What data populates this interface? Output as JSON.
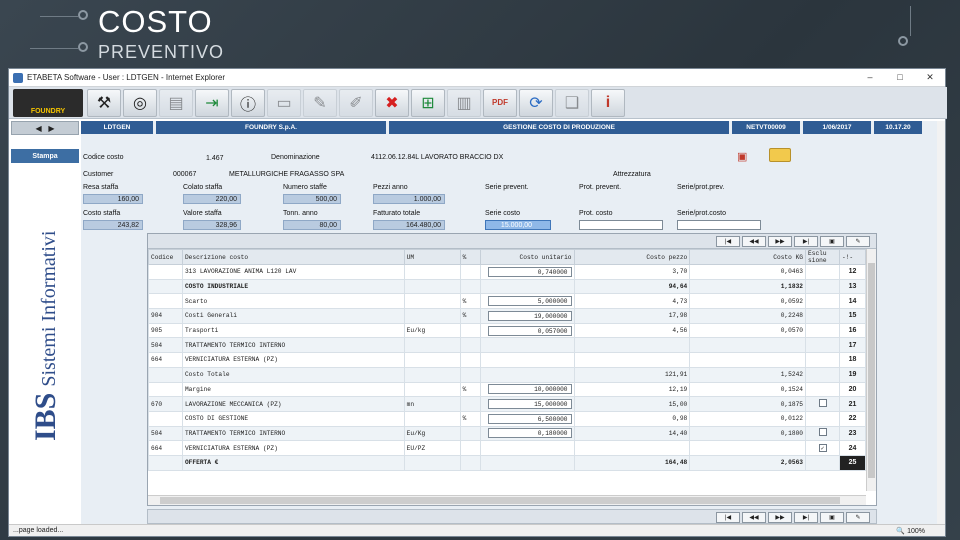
{
  "slide": {
    "title": "COSTO",
    "subtitle": "PREVENTIVO"
  },
  "window": {
    "title": "ETABETA Software - User : LDTGEN - Internet Explorer",
    "controls": [
      "–",
      "□",
      "✕"
    ]
  },
  "toolbar": {
    "logo_text": "FOUNDRY",
    "buttons": [
      {
        "icon": "wrench-icon",
        "glyph": "⚒"
      },
      {
        "icon": "disc-icon",
        "glyph": "◎"
      },
      {
        "icon": "faded-doc-icon",
        "glyph": "▤"
      },
      {
        "icon": "exit-icon",
        "glyph": "⇥"
      },
      {
        "icon": "info-icon",
        "glyph": "ⓘ"
      },
      {
        "icon": "faded-folder-icon",
        "glyph": "▭"
      },
      {
        "icon": "faded-tools-icon",
        "glyph": "✎"
      },
      {
        "icon": "faded-pen-icon",
        "glyph": "✐"
      },
      {
        "icon": "delete-icon",
        "glyph": "✖"
      },
      {
        "icon": "excel-icon",
        "glyph": "⊞"
      },
      {
        "icon": "faded-report-icon",
        "glyph": "▥"
      },
      {
        "icon": "pdf-icon",
        "glyph": "PDF"
      },
      {
        "icon": "refresh-icon",
        "glyph": "⟳"
      },
      {
        "icon": "faded-book-icon",
        "glyph": "❑"
      },
      {
        "icon": "help-icon",
        "glyph": "i"
      }
    ]
  },
  "left_panel": {
    "stampa_label": "Stampa",
    "brand_ibs": "IBS",
    "brand_rest": "Sistemi Informativi"
  },
  "header": {
    "user": "LDTGEN",
    "company": "FOUNDRY S.p.A.",
    "module": "GESTIONE COSTO DI PRODUZIONE",
    "code": "NETVT00009",
    "date": "1/06/2017",
    "time": "10.17.20"
  },
  "form": {
    "codice_costo_label": "Codice costo",
    "codice_costo": "1.467",
    "denominazione_label": "Denominazione",
    "denominazione": "4112.06.12.84L LAVORATO BRACCIO DX",
    "customer_label": "Customer",
    "customer_code": "000067",
    "customer_name": "METALLURGICHE FRAGASSO SPA",
    "attrezzatura_label": "Attrezzatura",
    "resa_staffa_label": "Resa    staffa",
    "resa_staffa": "160,00",
    "colato_staffa_label": "Colato staffa",
    "colato_staffa": "220,00",
    "numero_staffe_label": "Numero staffe",
    "numero_staffe": "500,00",
    "pezzi_anno_label": "Pezzi    anno",
    "pezzi_anno": "1.000,00",
    "serie_prevent_label": "Serie prevent.",
    "prot_prevent_label": "Prot. prevent.",
    "serie_prot_prev_label": "Serie/prot.prev.",
    "costo_staffa_label": "Costo   staffa",
    "costo_staffa": "243,82",
    "valore_staffa_label": "Valore staffa",
    "valore_staffa": "328,96",
    "tonn_anno_label": "Tonn. anno",
    "tonn_anno": "80,00",
    "fatturato_totale_label": "Fatturato totale",
    "fatturato_totale": "164.480,00",
    "serie_costo_label": "Serie costo",
    "serie_costo": "15.000,00",
    "prot_costo_label": "Prot. costo",
    "serie_prot_costo_label": "Serie/prot.costo"
  },
  "nav": [
    "|◀",
    "◀◀",
    "▶▶",
    "▶|",
    "▣",
    "✎"
  ],
  "grid": {
    "columns": [
      "Codice",
      "Descrizione costo",
      "UM",
      "%",
      "Costo unitario",
      "Costo pezzo",
      "Costo KG",
      "Esclu sione",
      "-!-"
    ],
    "rows": [
      {
        "codice": "",
        "descr": "313 LAVORAZIONE ANIMA L120 LAV",
        "um": "",
        "pct": "",
        "unit": "0,740000",
        "pezzo": "3,70",
        "kg": "0,0463",
        "esc": "",
        "n": "12"
      },
      {
        "codice": "",
        "descr": "COSTO INDUSTRIALE",
        "um": "",
        "pct": "",
        "unit": "",
        "pezzo": "94,64",
        "kg": "1,1832",
        "esc": "",
        "n": "13",
        "bold": true
      },
      {
        "codice": "",
        "descr": "Scarto",
        "um": "",
        "pct": "%",
        "unit": "5,000000",
        "pezzo": "4,73",
        "kg": "0,0592",
        "esc": "",
        "n": "14"
      },
      {
        "codice": "904",
        "descr": "Costi Generali",
        "um": "",
        "pct": "%",
        "unit": "19,000000",
        "pezzo": "17,98",
        "kg": "0,2248",
        "esc": "",
        "n": "15"
      },
      {
        "codice": "905",
        "descr": "Trasporti",
        "um": "Eu/kg",
        "pct": "",
        "unit": "0,057000",
        "pezzo": "4,56",
        "kg": "0,0570",
        "esc": "",
        "n": "16"
      },
      {
        "codice": "504",
        "descr": "TRATTAMENTO TERMICO INTERNO",
        "um": "",
        "pct": "",
        "unit": "",
        "pezzo": "",
        "kg": "",
        "esc": "",
        "n": "17"
      },
      {
        "codice": "664",
        "descr": "VERNICIATURA ESTERNA (PZ)",
        "um": "",
        "pct": "",
        "unit": "",
        "pezzo": "",
        "kg": "",
        "esc": "",
        "n": "18"
      },
      {
        "codice": "",
        "descr": "Costo Totale",
        "um": "",
        "pct": "",
        "unit": "",
        "pezzo": "121,91",
        "kg": "1,5242",
        "esc": "",
        "n": "19"
      },
      {
        "codice": "",
        "descr": "Margine",
        "um": "",
        "pct": "%",
        "unit": "10,000000",
        "pezzo": "12,19",
        "kg": "0,1524",
        "esc": "",
        "n": "20"
      },
      {
        "codice": "670",
        "descr": "LAVORAZIONE MECCANICA (PZ)",
        "um": "mn",
        "pct": "",
        "unit": "15,000000",
        "pezzo": "15,00",
        "kg": "0,1875",
        "esc": "box",
        "n": "21"
      },
      {
        "codice": "",
        "descr": "COSTO DI GESTIONE",
        "um": "",
        "pct": "%",
        "unit": "6,500000",
        "pezzo": "0,98",
        "kg": "0,0122",
        "esc": "",
        "n": "22"
      },
      {
        "codice": "504",
        "descr": "TRATTAMENTO TERMICO INTERNO",
        "um": "Eu/Kg",
        "pct": "",
        "unit": "0,180000",
        "pezzo": "14,40",
        "kg": "0,1800",
        "esc": "box",
        "n": "23"
      },
      {
        "codice": "664",
        "descr": "VERNICIATURA ESTERNA (PZ)",
        "um": "EU/PZ",
        "pct": "",
        "unit": "",
        "pezzo": "",
        "kg": "",
        "esc": "checked",
        "n": "24"
      },
      {
        "codice": "",
        "descr": "OFFERTA  €",
        "um": "",
        "pct": "",
        "unit": "",
        "pezzo": "164,48",
        "kg": "2,0563",
        "esc": "",
        "n": "25",
        "bold": true
      }
    ]
  },
  "status": {
    "text": "...page loaded...",
    "zoom": "100%"
  }
}
